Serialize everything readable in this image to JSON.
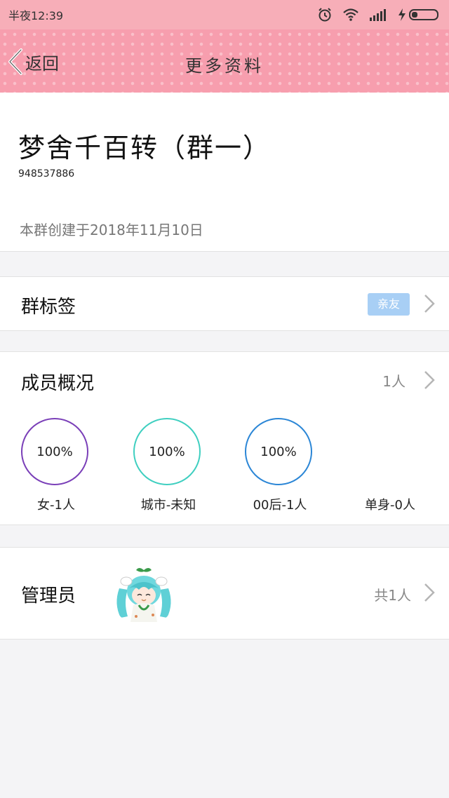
{
  "status_bar": {
    "time": "半夜12:39"
  },
  "nav": {
    "back_label": "返回",
    "title": "更多资料"
  },
  "group": {
    "name": "梦舍千百转（群一）",
    "id": "948537886",
    "created": "本群创建于2018年11月10日"
  },
  "tags": {
    "title": "群标签",
    "badge": "亲友"
  },
  "members": {
    "title": "成员概况",
    "count": "1人",
    "stats": [
      {
        "value": "100%",
        "label": "女-1人",
        "color": "#7a3fb8"
      },
      {
        "value": "100%",
        "label": "城市-未知",
        "color": "#3fcfc0"
      },
      {
        "value": "100%",
        "label": "00后-1人",
        "color": "#2b86d6"
      },
      {
        "value": "",
        "label": "单身-0人",
        "color": ""
      }
    ]
  },
  "admin": {
    "title": "管理员",
    "count": "共1人"
  },
  "colors": {
    "status_bg": "#f7aeb8",
    "nav_bg": "#f79eae",
    "tag_bg": "#a8cff5"
  }
}
